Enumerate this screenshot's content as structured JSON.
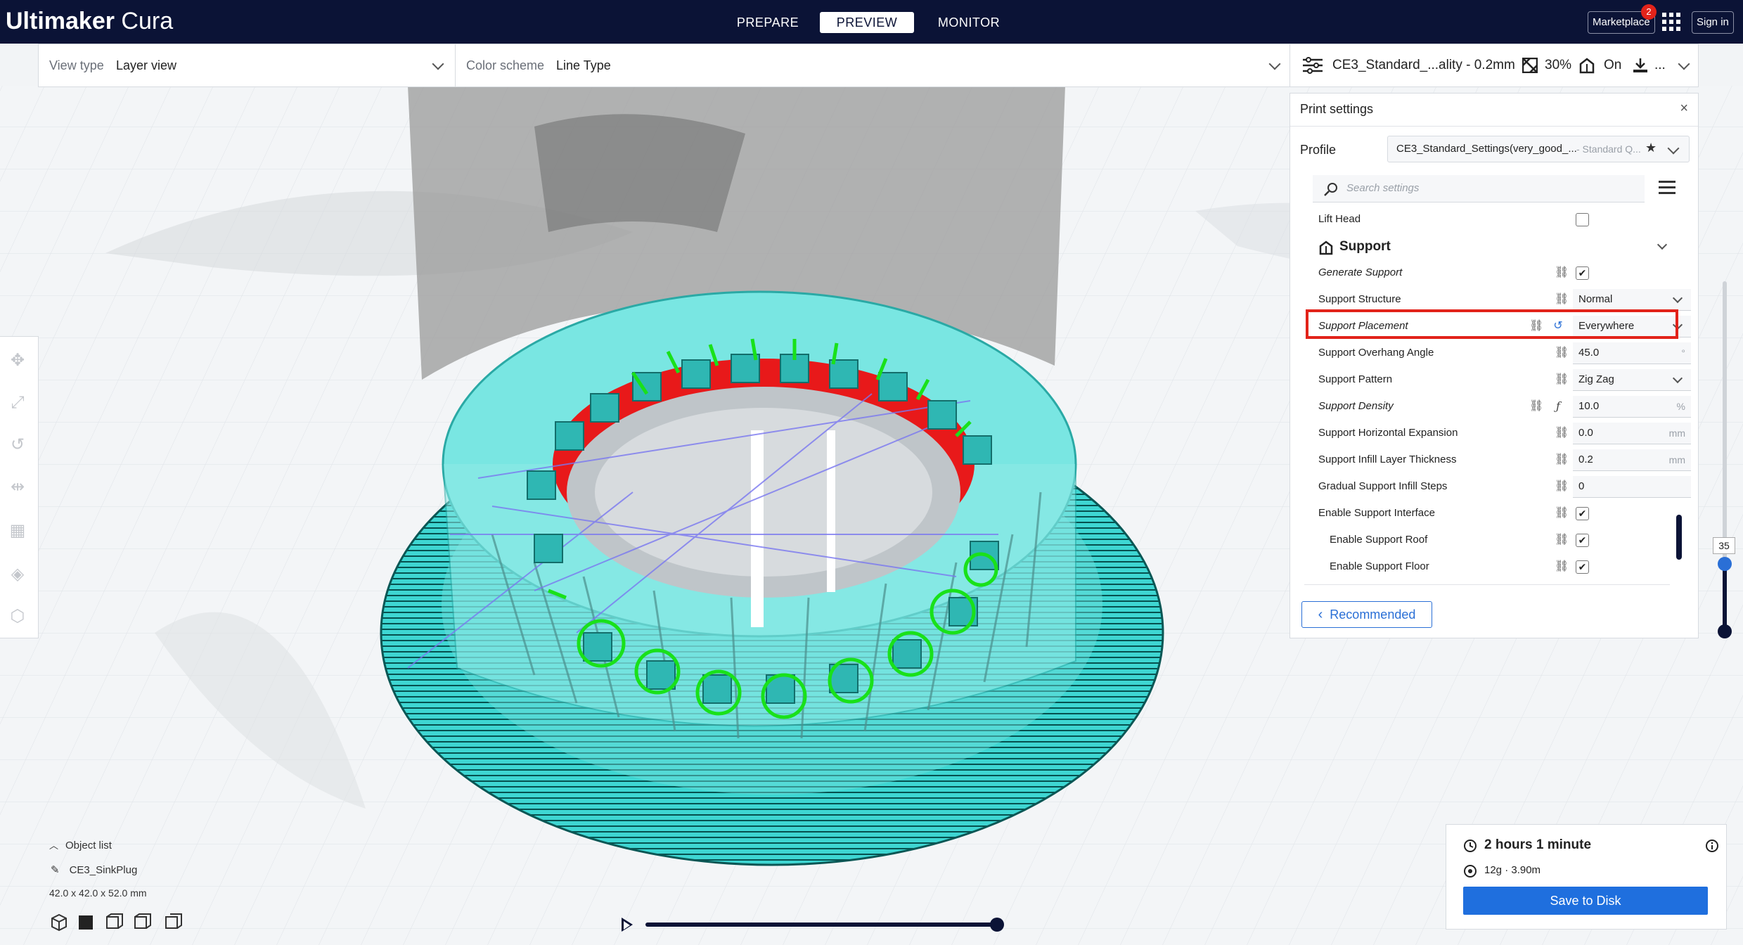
{
  "app": {
    "brand_bold": "Ultimaker",
    "brand_light": "Cura"
  },
  "stages": {
    "prepare": "PREPARE",
    "preview": "PREVIEW",
    "monitor": "MONITOR"
  },
  "header": {
    "marketplace": "Marketplace",
    "marketplace_badge": "2",
    "sign_in": "Sign in"
  },
  "view_bar": {
    "view_type_label": "View type",
    "view_type_value": "Layer view",
    "color_scheme_label": "Color scheme",
    "color_scheme_value": "Line Type"
  },
  "print_bar": {
    "profile": "CE3_Standard_...ality - 0.2mm",
    "infill": "30%",
    "support": "On",
    "adhesion": "..."
  },
  "print_settings": {
    "title": "Print settings",
    "close": "×",
    "profile_label": "Profile",
    "profile_name": "CE3_Standard_Settings(very_good_...",
    "profile_quality": "- Standard Q...",
    "search_placeholder": "Search settings",
    "lift_head": "Lift Head",
    "section": "Support",
    "settings": [
      {
        "label": "Generate Support",
        "type": "checkbox",
        "value": "✔"
      },
      {
        "label": "Support Structure",
        "type": "select",
        "value": "Normal"
      },
      {
        "label": "Support Placement",
        "type": "select",
        "value": "Everywhere"
      },
      {
        "label": "Support Overhang Angle",
        "type": "number",
        "value": "45.0",
        "unit": "°"
      },
      {
        "label": "Support Pattern",
        "type": "select",
        "value": "Zig Zag"
      },
      {
        "label": "Support Density",
        "type": "number",
        "value": "10.0",
        "unit": "%"
      },
      {
        "label": "Support Horizontal Expansion",
        "type": "number",
        "value": "0.0",
        "unit": "mm"
      },
      {
        "label": "Support Infill Layer Thickness",
        "type": "number",
        "value": "0.2",
        "unit": "mm"
      },
      {
        "label": "Gradual Support Infill Steps",
        "type": "number",
        "value": "0",
        "unit": ""
      },
      {
        "label": "Enable Support Interface",
        "type": "checkbox",
        "value": "✔"
      },
      {
        "label": "Enable Support Roof",
        "type": "checkbox",
        "value": "✔"
      },
      {
        "label": "Enable Support Floor",
        "type": "checkbox",
        "value": "✔"
      }
    ],
    "recommended": "Recommended"
  },
  "layer_slider": {
    "value": "35"
  },
  "object_list": {
    "title": "Object list",
    "object_name": "CE3_SinkPlug",
    "dimensions": "42.0 x 42.0 x 52.0 mm"
  },
  "estimate": {
    "time": "2 hours 1 minute",
    "material": "12g · 3.90m",
    "save": "Save to Disk"
  },
  "colors": {
    "header_bg": "#0b1336",
    "accent": "#1f6fde",
    "highlight": "#e2231a",
    "wall": "#39d5d0",
    "support": "#e8191a",
    "travel": "#7a78f0"
  }
}
